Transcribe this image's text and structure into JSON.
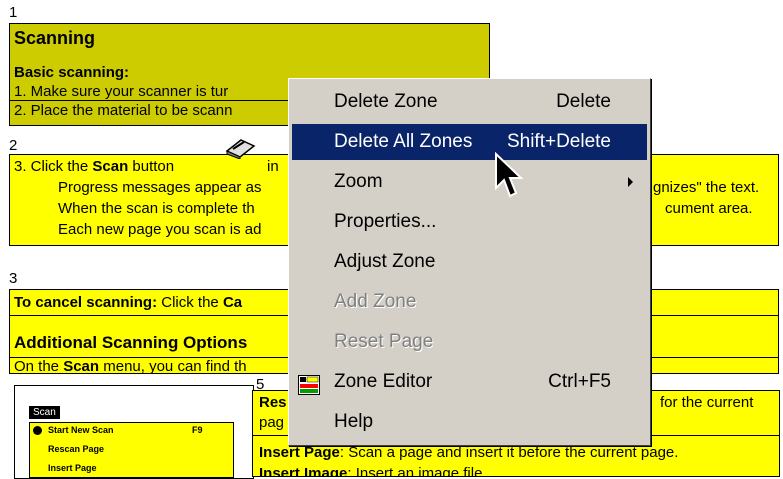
{
  "zones": [
    {
      "number": "1",
      "title": "Scanning",
      "subtitle": "Basic scanning:",
      "lines": [
        "1.   Make sure your scanner is tur",
        "2.   Place the material to be scann"
      ]
    },
    {
      "number": "2",
      "line1_pre": "3.   Click the ",
      "line1_bold": "Scan",
      "line1_post": " button",
      "line1_in": "in",
      "lines": [
        "Progress messages appear as",
        "When the scan is complete th",
        "Each new page you scan is ad"
      ],
      "right_lines": [
        "gnizes\" the text.",
        "cument area."
      ]
    },
    {
      "number": "3",
      "cancel_bold": "To cancel scanning:",
      "cancel_text": " Click the ",
      "cancel_ca": "Ca",
      "heading": "Additional Scanning Options",
      "menu_pre": "On the ",
      "menu_bold": "Scan",
      "menu_post": " menu, you can find th"
    },
    {
      "number": "5",
      "rows": [
        {
          "bold": "Res",
          "text": "",
          "tail": "for the current"
        },
        {
          "bold": "",
          "text": "pag",
          "tail": ""
        },
        {
          "bold": "Insert Page",
          "text": ": Scan a page and insert it before the current page.",
          "tail": ""
        },
        {
          "bold": "Insert Image",
          "text": ": Insert an image file.",
          "tail": ""
        }
      ]
    }
  ],
  "scan_menu": {
    "title": "Scan",
    "items": [
      {
        "label": "Start New Scan",
        "shortcut": "F9"
      },
      {
        "label": "Rescan Page",
        "shortcut": ""
      },
      {
        "label": "Insert Page",
        "shortcut": ""
      }
    ]
  },
  "context_menu": {
    "items": [
      {
        "label": "Delete Zone",
        "shortcut": "Delete"
      },
      {
        "label": "Delete All Zones",
        "shortcut": "Shift+Delete"
      },
      {
        "label": "Zoom",
        "shortcut": ""
      },
      {
        "label": "Properties...",
        "shortcut": ""
      },
      {
        "label": "Adjust Zone",
        "shortcut": ""
      },
      {
        "label": "Add Zone",
        "shortcut": ""
      },
      {
        "label": "Reset Page",
        "shortcut": ""
      },
      {
        "label": "Zone Editor",
        "shortcut": "Ctrl+F5"
      },
      {
        "label": "Help",
        "shortcut": ""
      }
    ],
    "selected_index": 1,
    "disabled": [
      "Add Zone",
      "Reset Page"
    ]
  },
  "colors": {
    "zone_yellow": "#ffff00",
    "zone_olive": "#cccc00",
    "menu_bg": "#d4d0c8",
    "highlight": "#0a246a"
  },
  "icons": [
    "scanner-icon",
    "submenu-arrow-icon",
    "zone-editor-icon",
    "mouse-pointer-icon"
  ]
}
